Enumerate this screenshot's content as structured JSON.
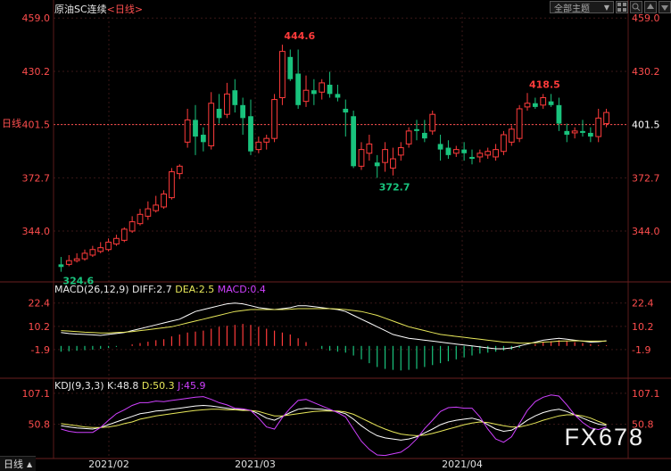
{
  "header": {
    "symbol": "原油SC连续",
    "period_open": "<",
    "period": "日线",
    "period_close": ">"
  },
  "toolbar": {
    "theme_select": "全部主题",
    "theme_arrow": "▼"
  },
  "side_label_period": "日线",
  "price_axis": {
    "ticks": [
      459.0,
      430.2,
      401.5,
      372.7,
      344.0
    ],
    "tick_labels": [
      "459.0",
      "430.2",
      "401.5",
      "372.7",
      "344.0"
    ],
    "current_price_label": "401.5",
    "ylim": [
      317.5,
      462.0
    ]
  },
  "annotations": {
    "high": "444.6",
    "low": "324.6",
    "local_low": "372.7",
    "local_high": "418.5"
  },
  "macd": {
    "title": "MACD(26,12,9)",
    "diff": "DIFF:2.7",
    "dea": "DEA:2.5",
    "macd": "MACD:0.4",
    "tick_labels": [
      "22.4",
      "10.2",
      "-1.9"
    ],
    "ylim": [
      -15,
      26
    ]
  },
  "kdj": {
    "title": "KDJ(9,3,3)",
    "k": "K:48.8",
    "d": "D:50.3",
    "j": "J:45.9",
    "tick_labels": [
      "107.1",
      "50.8"
    ],
    "ylim": [
      -5,
      115
    ]
  },
  "date_labels": [
    "2021/02",
    "2021/03",
    "2021/04"
  ],
  "watermark": "FX678",
  "colors": {
    "up": "#ff3b3b",
    "down": "#19c37d",
    "price_axis_text": "#ff4d4d",
    "diff_line": "#ffffff",
    "dea_line": "#e8e85a",
    "macd_text": "#d040ff",
    "grid": "#3a1a1a",
    "current_line": "#ff5050",
    "date_text": "#e0e0e0"
  },
  "chart_data": {
    "type": "candlestick",
    "ohlc": [
      [
        326,
        330,
        322,
        324.6
      ],
      [
        326,
        331,
        325,
        328
      ],
      [
        328,
        332,
        327,
        329
      ],
      [
        329,
        334,
        328,
        332
      ],
      [
        331,
        336,
        330,
        334
      ],
      [
        333,
        338,
        332,
        335
      ],
      [
        334,
        340,
        333,
        338
      ],
      [
        337,
        342,
        336,
        340
      ],
      [
        339,
        346,
        338,
        345
      ],
      [
        344,
        352,
        343,
        349
      ],
      [
        348,
        356,
        347,
        353
      ],
      [
        352,
        360,
        350,
        356
      ],
      [
        355,
        363,
        354,
        358
      ],
      [
        357,
        366,
        356,
        364
      ],
      [
        362,
        378,
        361,
        376
      ],
      [
        375,
        380,
        372,
        379
      ],
      [
        392,
        410,
        389,
        404
      ],
      [
        404,
        412,
        385,
        395
      ],
      [
        396,
        400,
        387,
        392
      ],
      [
        390,
        419,
        388,
        413
      ],
      [
        410,
        418,
        402,
        405
      ],
      [
        407,
        424,
        405,
        418
      ],
      [
        420,
        426,
        408,
        412
      ],
      [
        412,
        416,
        396,
        405
      ],
      [
        406,
        415,
        385,
        387
      ],
      [
        388,
        395,
        386,
        392
      ],
      [
        392,
        396,
        388,
        394
      ],
      [
        394,
        418,
        392,
        415
      ],
      [
        416,
        444.6,
        412,
        441
      ],
      [
        438,
        442,
        425,
        426
      ],
      [
        429,
        442,
        410,
        412
      ],
      [
        414,
        428,
        411,
        420
      ],
      [
        420,
        426,
        412,
        418
      ],
      [
        419,
        426,
        415,
        424
      ],
      [
        423,
        430,
        416,
        418
      ],
      [
        418,
        423,
        414,
        416
      ],
      [
        410,
        415,
        395,
        408
      ],
      [
        406,
        409,
        378,
        379
      ],
      [
        379,
        392,
        377,
        388
      ],
      [
        386,
        396,
        382,
        391
      ],
      [
        381,
        385,
        372.7,
        379
      ],
      [
        381,
        392,
        376,
        388
      ],
      [
        378,
        389,
        374,
        383
      ],
      [
        385,
        392,
        382,
        389
      ],
      [
        391,
        400,
        389,
        398
      ],
      [
        399,
        404,
        393,
        398
      ],
      [
        397,
        404,
        392,
        394
      ],
      [
        398,
        409,
        396,
        407
      ],
      [
        391,
        396,
        382,
        388
      ],
      [
        389,
        393,
        383,
        385
      ],
      [
        386,
        390,
        384,
        388
      ],
      [
        388,
        392,
        382,
        386
      ],
      [
        384,
        388,
        380,
        383
      ],
      [
        384,
        388,
        381,
        386
      ],
      [
        385,
        389,
        383,
        387
      ],
      [
        384,
        391,
        382,
        388
      ],
      [
        387,
        398,
        385,
        396
      ],
      [
        392,
        401,
        390,
        399
      ],
      [
        394,
        412,
        392,
        410
      ],
      [
        411,
        418.5,
        409,
        413
      ],
      [
        413,
        416,
        410,
        411
      ],
      [
        412,
        418,
        410,
        416
      ],
      [
        414,
        418,
        411,
        412
      ],
      [
        412,
        416,
        398,
        402
      ],
      [
        398,
        402,
        392,
        396
      ],
      [
        397,
        400,
        394,
        398
      ],
      [
        398,
        404,
        395,
        397
      ],
      [
        397,
        400,
        392,
        395
      ],
      [
        395,
        410,
        392,
        405
      ],
      [
        402,
        410,
        400,
        408
      ]
    ],
    "macd_hist": [
      -3,
      -2.8,
      -2.5,
      -2.2,
      -2,
      -1.5,
      -1,
      -0.5,
      0,
      0.8,
      1.5,
      2.2,
      3,
      3.5,
      5,
      6,
      7,
      7.5,
      8,
      9,
      10,
      10.5,
      11,
      11.5,
      11,
      10,
      9,
      8,
      7,
      6,
      4,
      2,
      0,
      -1.5,
      -2.5,
      -3,
      -3.5,
      -5,
      -7,
      -9,
      -11,
      -12,
      -12.5,
      -12.8,
      -12.5,
      -12,
      -11,
      -10,
      -9,
      -8,
      -7,
      -6,
      -5,
      -4,
      -3.5,
      -3,
      -2.5,
      -2,
      -1,
      0,
      1,
      2,
      2.5,
      3,
      2.5,
      2,
      1.5,
      1,
      0.5,
      0.4
    ],
    "diff": [
      7,
      6.5,
      6.2,
      6,
      5.8,
      5.5,
      6,
      6.5,
      7,
      8,
      9,
      10,
      11,
      12,
      13,
      14,
      16,
      18,
      19,
      20,
      21,
      22,
      22.4,
      22,
      21,
      20,
      19.5,
      19,
      19.5,
      20,
      21,
      21,
      20.5,
      20,
      19.5,
      19,
      18,
      16,
      14,
      12,
      10,
      8,
      6,
      5,
      4,
      3.5,
      3,
      2.5,
      2,
      1.5,
      1,
      0.5,
      0,
      -0.5,
      -1,
      -1.5,
      -1.5,
      -1,
      0,
      1,
      2,
      3,
      3.5,
      4,
      3.5,
      3,
      2.5,
      2,
      2.2,
      2.7
    ],
    "dea": [
      8,
      7.8,
      7.5,
      7.2,
      7,
      6.8,
      6.8,
      7,
      7.2,
      7.5,
      8,
      8.5,
      9,
      9.5,
      10,
      11,
      12,
      13,
      14,
      15,
      16,
      17,
      18,
      18.5,
      19,
      19,
      19,
      19,
      19,
      19.2,
      19.5,
      19.5,
      19.5,
      19.5,
      19.5,
      19.3,
      19,
      18.5,
      18,
      17,
      16,
      14.5,
      13,
      11.5,
      10,
      9,
      8,
      7,
      6,
      5.5,
      5,
      4.5,
      4,
      3.5,
      3,
      2.5,
      2,
      1.8,
      1.5,
      1.5,
      1.7,
      2,
      2.2,
      2.5,
      2.6,
      2.7,
      2.6,
      2.5,
      2.5,
      2.5
    ],
    "kdj_k": [
      48,
      46,
      44,
      43,
      42,
      45,
      50,
      55,
      60,
      65,
      70,
      72,
      75,
      76,
      78,
      80,
      82,
      84,
      85,
      84,
      82,
      80,
      78,
      77,
      76,
      70,
      62,
      58,
      65,
      72,
      78,
      80,
      79,
      78,
      76,
      74,
      70,
      60,
      48,
      38,
      30,
      26,
      24,
      22,
      24,
      28,
      35,
      42,
      50,
      55,
      58,
      60,
      62,
      58,
      50,
      42,
      38,
      40,
      48,
      58,
      66,
      72,
      76,
      78,
      74,
      68,
      62,
      56,
      51,
      48.8
    ],
    "kdj_d": [
      52,
      50,
      48,
      46,
      45,
      45,
      46,
      48,
      52,
      55,
      60,
      63,
      66,
      68,
      70,
      72,
      74,
      76,
      77,
      78,
      78,
      77,
      77,
      76,
      76,
      74,
      70,
      66,
      66,
      68,
      70,
      72,
      74,
      75,
      75,
      75,
      73,
      69,
      62,
      55,
      48,
      42,
      37,
      33,
      31,
      30,
      31,
      34,
      38,
      42,
      46,
      50,
      53,
      55,
      54,
      51,
      48,
      46,
      46,
      49,
      53,
      58,
      62,
      66,
      68,
      68,
      66,
      62,
      56,
      50.3
    ],
    "kdj_j": [
      42,
      38,
      36,
      36,
      36,
      45,
      58,
      70,
      77,
      85,
      90,
      90,
      93,
      92,
      94,
      96,
      98,
      100,
      101,
      96,
      90,
      86,
      80,
      79,
      76,
      62,
      46,
      42,
      63,
      80,
      94,
      96,
      90,
      84,
      78,
      72,
      64,
      42,
      20,
      5,
      -5,
      -6,
      -3,
      0,
      10,
      24,
      43,
      58,
      74,
      81,
      82,
      80,
      80,
      64,
      42,
      24,
      18,
      28,
      52,
      76,
      92,
      100,
      104,
      102,
      86,
      68,
      54,
      44,
      41,
      45.9
    ]
  }
}
